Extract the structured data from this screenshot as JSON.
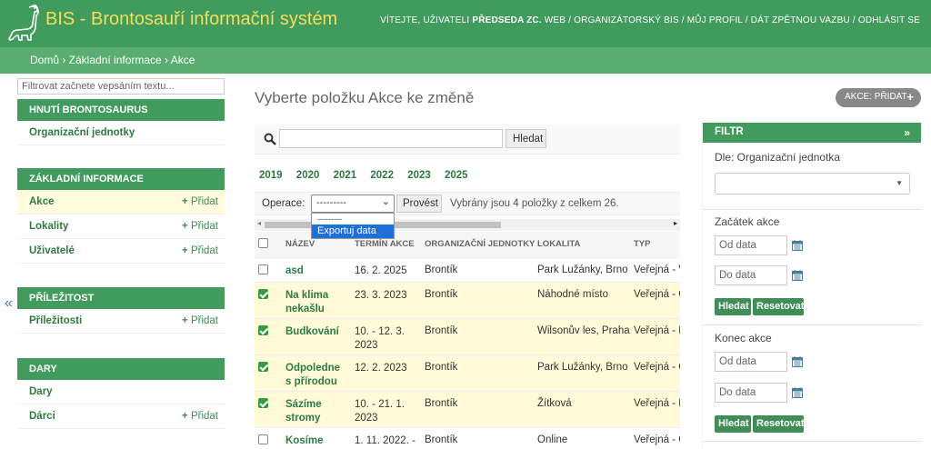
{
  "header": {
    "brand": "BIS - Brontosauří informační systém",
    "welcome": "VÍTEJTE, UŽIVATELI",
    "username": "PŘEDSEDA ZC.",
    "links": [
      "WEB",
      "ORGANIZÁTORSKÝ BIS",
      "MŮJ PROFIL",
      "DÁT ZPĚTNOU VAZBU",
      "ODHLÁSIT SE"
    ]
  },
  "breadcrumbs": "Domů › Základní informace › Akce",
  "sidebar": {
    "filter_placeholder": "Filtrovat začnete vepsáním textu...",
    "collapse": "«",
    "modules": [
      {
        "title": "HNUTÍ BRONTOSAURUS",
        "items": [
          {
            "label": "Organizační jednotky",
            "add": ""
          }
        ]
      },
      {
        "title": "ZÁKLADNÍ INFORMACE",
        "items": [
          {
            "label": "Akce",
            "add": "Přidat"
          },
          {
            "label": "Lokality",
            "add": "Přidat"
          },
          {
            "label": "Uživatelé",
            "add": "Přidat"
          }
        ]
      },
      {
        "title": "PŘÍLEŽITOST",
        "items": [
          {
            "label": "Příležitosti",
            "add": "Přidat"
          }
        ]
      },
      {
        "title": "DARY",
        "items": [
          {
            "label": "Dary",
            "add": ""
          },
          {
            "label": "Dárci",
            "add": "Přidat"
          }
        ]
      }
    ]
  },
  "main": {
    "title": "Vyberte položku Akce ke změně",
    "add_button": "AKCE: PŘIDAT",
    "search_button": "Hledat",
    "years": [
      "2019",
      "2020",
      "2021",
      "2022",
      "2023",
      "2025"
    ],
    "actions_label": "Operace:",
    "actions_selected": "---------",
    "actions_options": [
      "---------",
      "Exportuj data"
    ],
    "go_button": "Provést",
    "selection_info": "Vybrány jsou 4 položky z celkem 26.",
    "columns": [
      "NÁZEV",
      "TERMÍN AKCE",
      "ORGANIZAČNÍ JEDNOTKY",
      "LOKALITA",
      "TYP"
    ],
    "rows": [
      {
        "checked": false,
        "name": "asd",
        "date": "16. 2. 2025",
        "org": "Brontík",
        "loc": "Park Lužánky, Brno",
        "type": "Veřejná - V"
      },
      {
        "checked": true,
        "name": "Na klima nekašlu",
        "date": "23. 3. 2023",
        "org": "Brontík",
        "loc": "Náhodné místo",
        "type": "Veřejná - Č"
      },
      {
        "checked": true,
        "name": "Budkování",
        "date": "10. - 12. 3. 2023",
        "org": "Brontík",
        "loc": "Wilsonův les, Praha",
        "type": "Veřejná - D"
      },
      {
        "checked": true,
        "name": "Odpoledne s přírodou",
        "date": "12. 2. 2023",
        "org": "Brontík",
        "loc": "Park Lužánky, Brno",
        "type": "Veřejná - O"
      },
      {
        "checked": true,
        "name": "Sázíme stromy",
        "date": "10. - 21. 1. 2023",
        "org": "Brontík",
        "loc": "Žítková",
        "type": "Veřejná - K"
      },
      {
        "checked": false,
        "name": "Kosíme",
        "date": "1. 11. 2022. -",
        "org": "Brontík",
        "loc": "Online",
        "type": "Veřejná - Č"
      }
    ]
  },
  "filter": {
    "title": "FILTR",
    "toggle": "»",
    "org_label": "Dle: Organizační jednotka",
    "start_label": "Začátek akce",
    "end_label": "Konec akce",
    "from_placeholder": "Od data",
    "to_placeholder": "Do data",
    "search_button": "Hledat",
    "reset_button": "Resetovat"
  },
  "colors": {
    "header": "#409b5c",
    "breadcrumbs": "#5aad70",
    "brand_text": "#f5dd5d",
    "selected_row": "#fffbd9",
    "link": "#2d7a42"
  }
}
